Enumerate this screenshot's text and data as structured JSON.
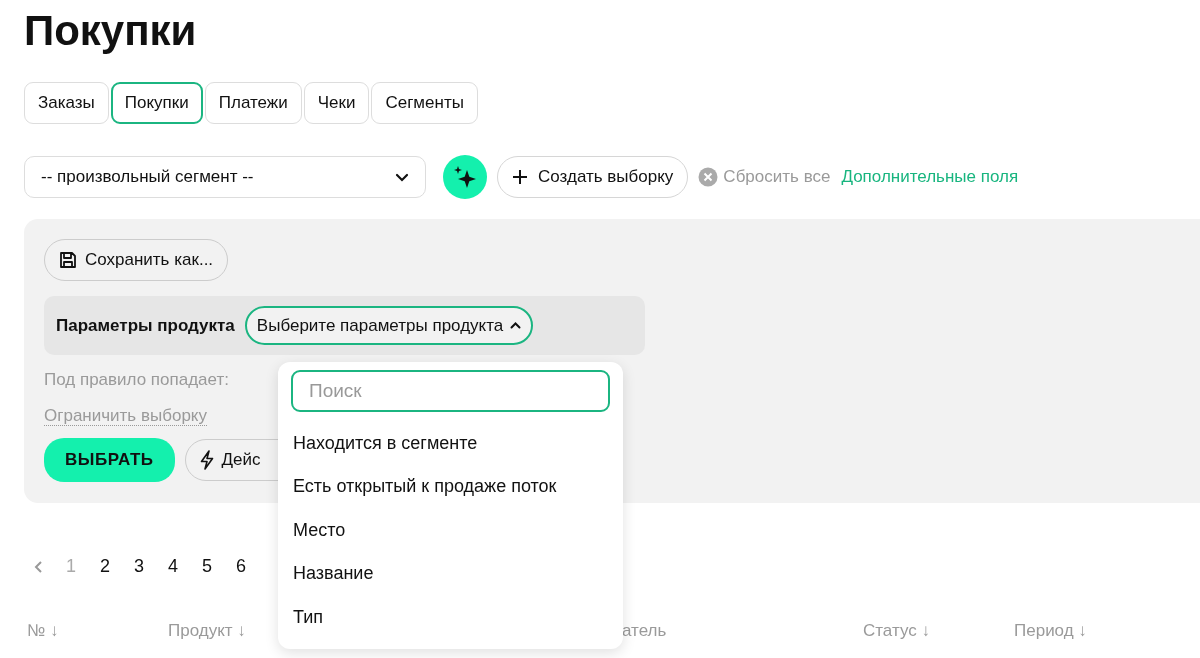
{
  "title": "Покупки",
  "tabs": [
    {
      "label": "Заказы",
      "selected": false
    },
    {
      "label": "Покупки",
      "selected": true
    },
    {
      "label": "Платежи",
      "selected": false
    },
    {
      "label": "Чеки",
      "selected": false
    },
    {
      "label": "Сегменты",
      "selected": false
    }
  ],
  "toolbar": {
    "segment_select": {
      "value": "-- произвольный сегмент --"
    },
    "create_button": "Создать выборку",
    "reset_button": "Сбросить все",
    "extra_fields_link": "Дополнительные поля"
  },
  "filter_panel": {
    "save_button": "Сохранить как...",
    "parameter": {
      "label": "Параметры продукта",
      "value": "Выберите параметры продукта",
      "expanded": true
    },
    "match_label": "Под правило попадает:",
    "limit_link": "Ограничить выборку",
    "select_button": "ВЫБРАТЬ",
    "actions_button": "Дейс"
  },
  "dropdown": {
    "search": {
      "placeholder": "Поиск"
    },
    "items": [
      "Находится в сегменте",
      "Есть открытый к продаже поток",
      "Место",
      "Название",
      "Тип"
    ]
  },
  "pagination": {
    "pages": [
      {
        "label": "1",
        "selected": true
      },
      {
        "label": "2",
        "selected": false
      },
      {
        "label": "3",
        "selected": false
      },
      {
        "label": "4",
        "selected": false
      },
      {
        "label": "5",
        "selected": false
      },
      {
        "label": "6",
        "selected": false
      }
    ]
  },
  "table": {
    "columns": [
      "№ ↓",
      "Продукт ↓",
      "атель",
      "Статус ↓",
      "Период ↓"
    ]
  }
}
